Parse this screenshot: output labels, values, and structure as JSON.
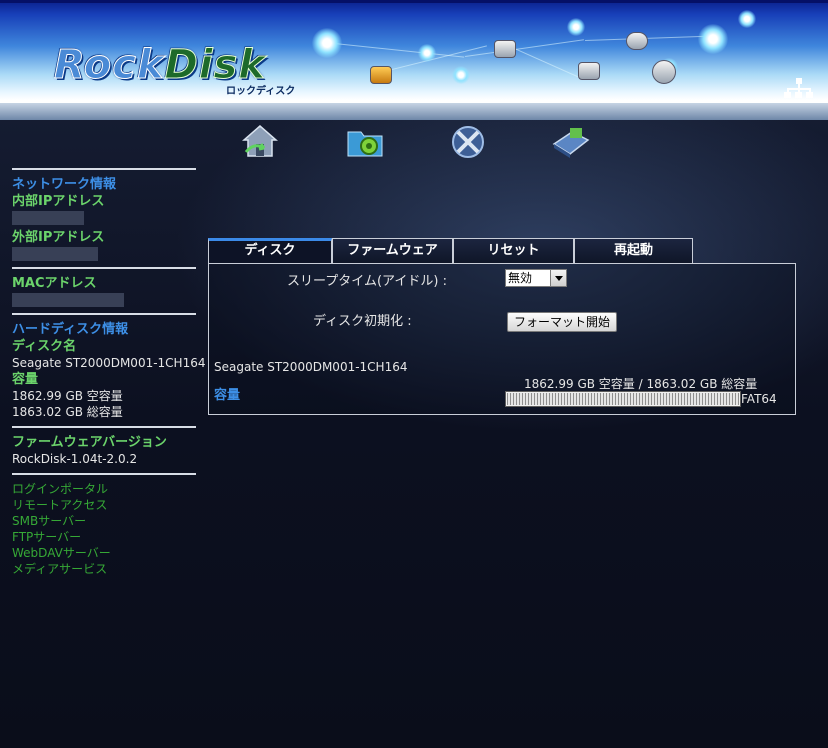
{
  "header": {
    "logo_text_rock": "Rock",
    "logo_text_disk": "Disk",
    "logo_subtitle": "ロックディスク"
  },
  "nav_icons": [
    "home-icon",
    "gear-folder-icon",
    "tools-icon",
    "software-icon"
  ],
  "sidebar": {
    "network_info": "ネットワーク情報",
    "internal_ip_label": "内部IPアドレス",
    "external_ip_label": "外部IPアドレス",
    "mac_label": "MACアドレス",
    "hdd_info": "ハードディスク情報",
    "disk_name_label": "ディスク名",
    "disk_name_value": "Seagate ST2000DM001-1CH164",
    "capacity_label": "容量",
    "free_value": "1862.99 GB 空容量",
    "total_value": "1863.02 GB 総容量",
    "firmware_label": "ファームウェアバージョン",
    "firmware_value": "RockDisk-1.04t-2.0.2",
    "links": [
      "ログインポータル",
      "リモートアクセス",
      "SMBサーバー",
      "FTPサーバー",
      "WebDAVサーバー",
      "メディアサービス"
    ]
  },
  "tabs": [
    "ディスク",
    "ファームウェア",
    "リセット",
    "再起動"
  ],
  "panel": {
    "sleep_label": "スリープタイム(アイドル) :",
    "sleep_value": "無効",
    "init_label": "ディスク初期化 :",
    "format_button": "フォーマット開始",
    "disk_name": "Seagate ST2000DM001-1CH164",
    "capacity_label": "容量",
    "capacity_text": "1862.99 GB 空容量 / 1863.02 GB 総容量",
    "filesystem": "FAT64",
    "free_fraction": 0.99998
  },
  "colors": {
    "accent_blue": "#3d8fe6",
    "accent_green": "#6bd36b",
    "link_green": "#36a836"
  }
}
